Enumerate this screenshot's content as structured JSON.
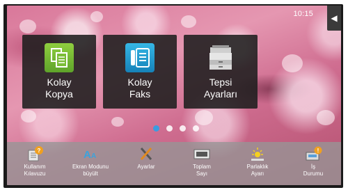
{
  "status": {
    "time": "10:15"
  },
  "side_tab_icon": "chevron-left-icon",
  "home_tiles": [
    {
      "label_line1": "Kolay",
      "label_line2": "Kopya",
      "icon": "copy-icon",
      "color": "#6cb534"
    },
    {
      "label_line1": "Kolay",
      "label_line2": "Faks",
      "icon": "fax-icon",
      "color": "#1e95cf"
    },
    {
      "label_line1": "Tepsi",
      "label_line2": "Ayarları",
      "icon": "printer-tray-icon",
      "color": "#d0d0d0"
    }
  ],
  "page_indicator": {
    "total": 4,
    "active": 1
  },
  "taskbar": [
    {
      "label_line1": "Kullanım",
      "label_line2": "Kılavuzu",
      "icon": "manual-help-icon"
    },
    {
      "label_line1": "Ekran Modunu",
      "label_line2": "büyült",
      "icon": "text-enlarge-icon"
    },
    {
      "label_line1": "Ayarlar",
      "label_line2": "",
      "icon": "wrench-screwdriver-icon"
    },
    {
      "label_line1": "Toplam",
      "label_line2": "Sayı",
      "icon": "counter-icon"
    },
    {
      "label_line1": "Parlaklık",
      "label_line2": "Ayarı",
      "icon": "brightness-icon"
    },
    {
      "label_line1": "İş",
      "label_line2": "Durumu",
      "icon": "job-status-icon"
    }
  ]
}
